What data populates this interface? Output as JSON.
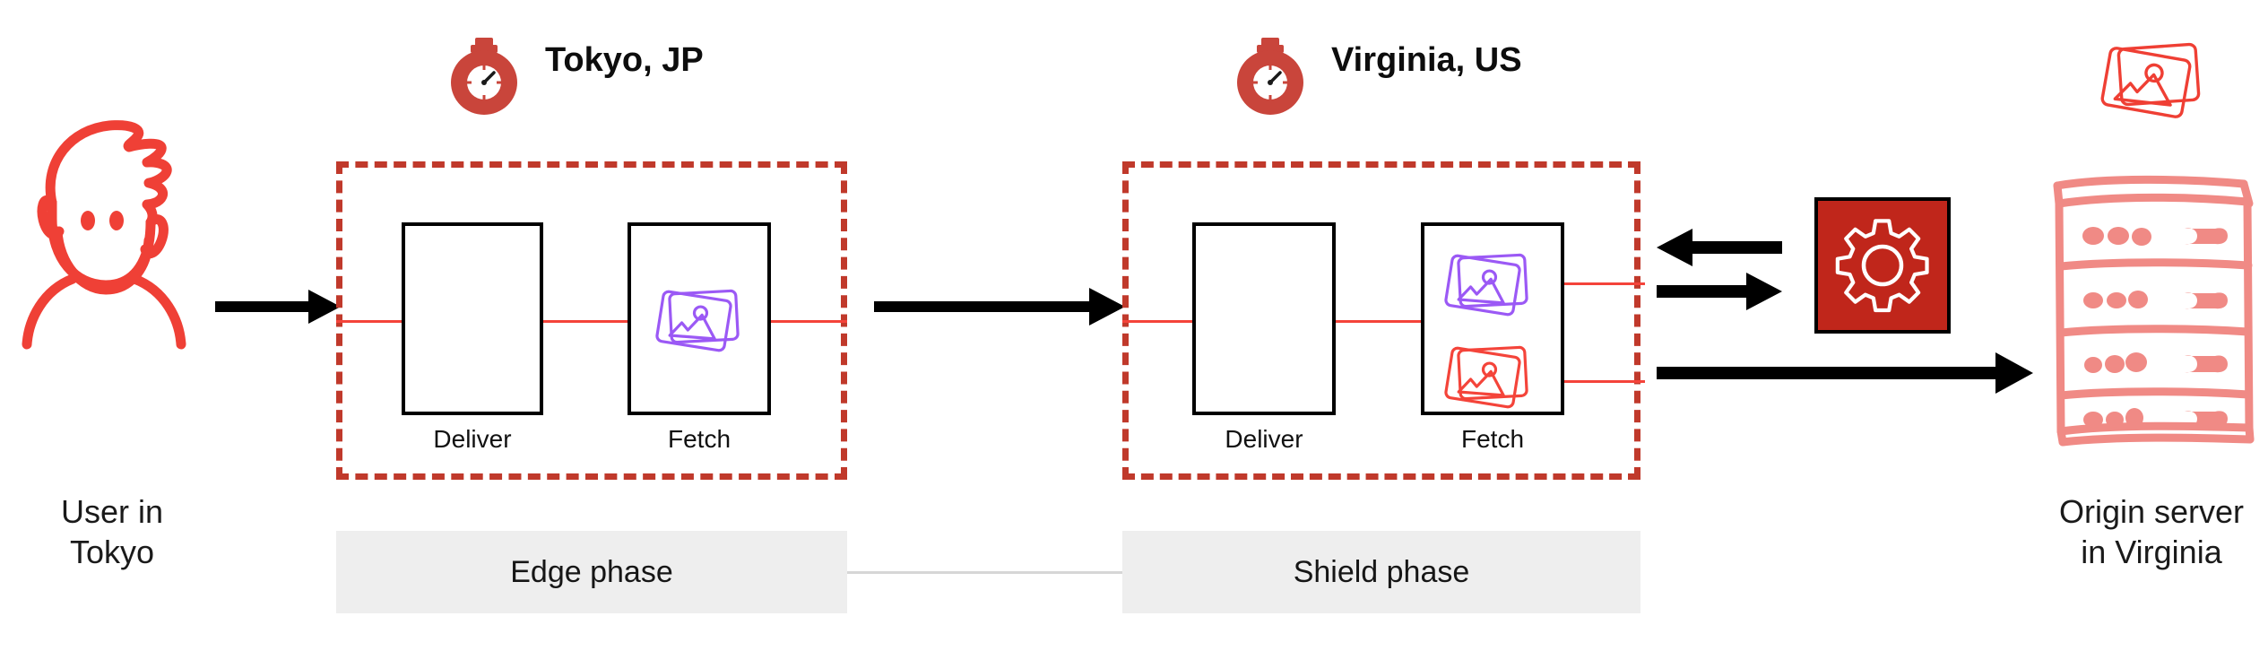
{
  "diagram": {
    "title_alt": "Fastly Image Optimizer edge and shield phase request flow",
    "colors": {
      "brand_red": "#c0392b",
      "wire_red": "#f4433a",
      "sketch_red": "#ef5350",
      "sketch_salmon": "#f08a85",
      "purple": "#9b59f5",
      "gear_box": "#c0261b",
      "phase_bar": "#eeeeee",
      "phase_link": "#d6d6d6",
      "arrow_black": "#000000",
      "text_black": "#1a1a1a"
    }
  },
  "user": {
    "caption": "User in\nTokyo",
    "icon": "user-avatar-icon"
  },
  "regions": [
    {
      "id": "tokyo",
      "title": "Tokyo, JP",
      "icon": "stopwatch-icon",
      "phase": {
        "label": "Edge phase"
      },
      "nodes": [
        {
          "id": "deliver",
          "label": "Deliver",
          "icons": []
        },
        {
          "id": "fetch",
          "label": "Fetch",
          "icons": [
            "image-stack-icon-purple"
          ]
        }
      ]
    },
    {
      "id": "virginia",
      "title": "Virginia, US",
      "icon": "stopwatch-icon",
      "phase": {
        "label": "Shield phase"
      },
      "nodes": [
        {
          "id": "deliver",
          "label": "Deliver",
          "icons": []
        },
        {
          "id": "fetch",
          "label": "Fetch",
          "icons": [
            "image-stack-icon-purple",
            "image-stack-icon-red"
          ]
        }
      ]
    }
  ],
  "optimizer": {
    "icon": "gear-icon",
    "name": "image-optimizer-node"
  },
  "origin": {
    "caption": "Origin server\nin Virginia",
    "icon": "server-rack-icon",
    "asset_icon": "image-stack-icon-red"
  },
  "arrows": [
    {
      "id": "user-to-edge",
      "direction": "right",
      "style": "black-solid"
    },
    {
      "id": "edge-to-shield",
      "direction": "right",
      "style": "black-solid"
    },
    {
      "id": "optimizer-out",
      "direction": "left",
      "style": "black-solid"
    },
    {
      "id": "optimizer-in",
      "direction": "right",
      "style": "black-solid"
    },
    {
      "id": "shield-to-origin",
      "direction": "right",
      "style": "black-solid"
    }
  ]
}
